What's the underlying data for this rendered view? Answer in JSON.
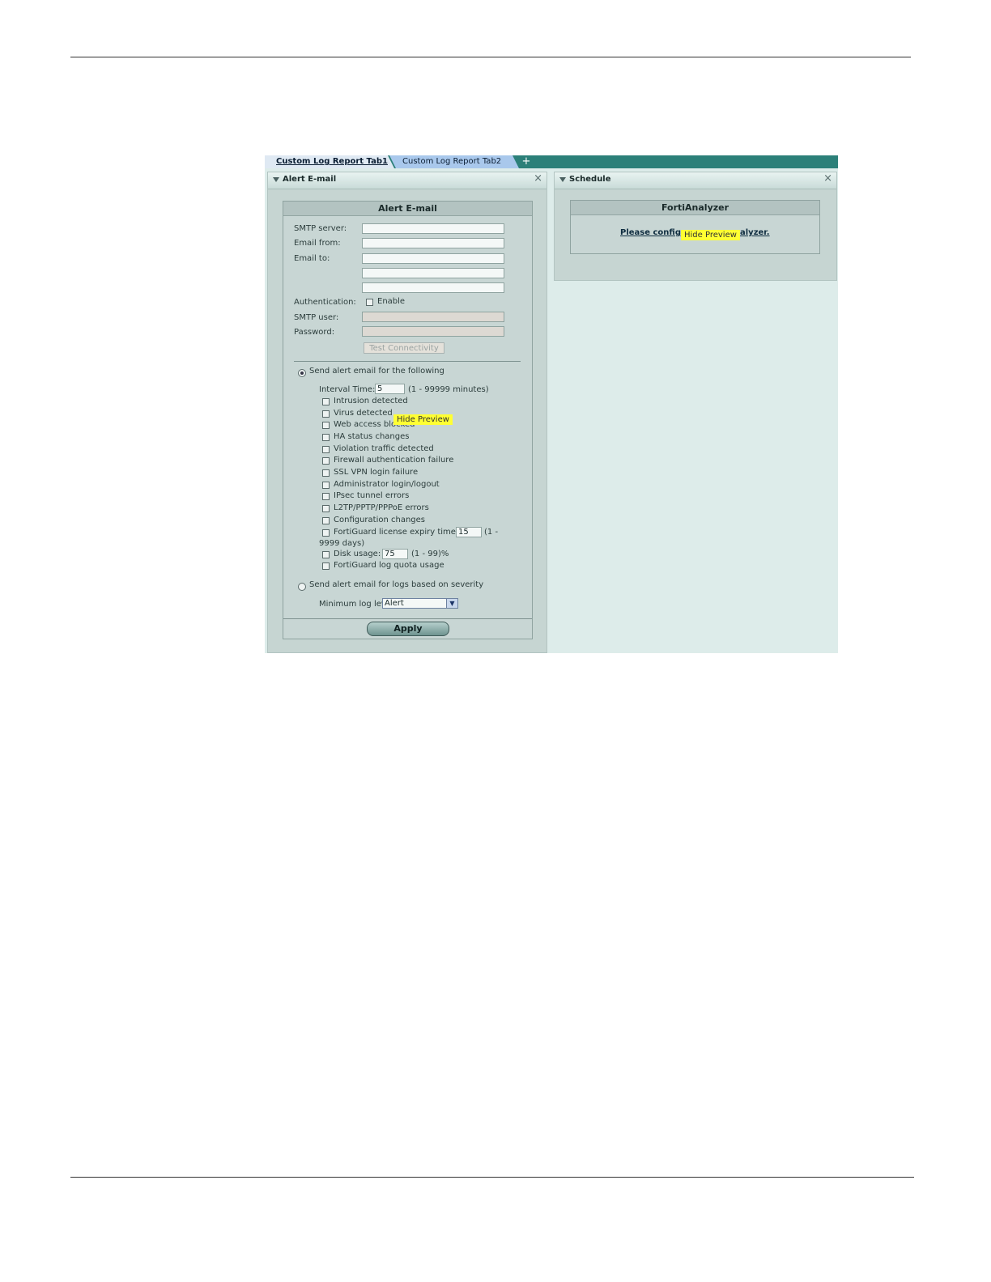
{
  "tabs": {
    "tab1": "Custom Log Report Tab1",
    "tab2": "Custom Log Report Tab2",
    "add": "+"
  },
  "alert_panel": {
    "title": "Alert E-mail",
    "close": "×",
    "section_title": "Alert E-mail",
    "smtp_server_label": "SMTP server:",
    "email_from_label": "Email from:",
    "email_to_label": "Email to:",
    "authentication_label": "Authentication:",
    "enable_label": "Enable",
    "smtp_user_label": "SMTP user:",
    "password_label": "Password:",
    "test_connectivity": "Test Connectivity",
    "send_following_label": "Send alert email for the following",
    "interval_label": "Interval Time:",
    "interval_value": "5",
    "interval_range": "(1 - 99999 minutes)",
    "events": [
      "Intrusion detected",
      "Virus detected",
      "Web access blocked",
      "HA status changes",
      "Violation traffic detected",
      "Firewall authentication failure",
      "SSL VPN login failure",
      "Administrator login/logout",
      "IPsec tunnel errors",
      "L2TP/PPTP/PPPoE errors",
      "Configuration changes"
    ],
    "fortiguard_label": "FortiGuard license expiry time:",
    "fortiguard_value": "15",
    "fortiguard_range_a": "(1 -",
    "fortiguard_range_b": "9999 days)",
    "disk_label": "Disk usage:",
    "disk_value": "75",
    "disk_range": "(1 - 99)%",
    "log_quota_label": "FortiGuard log quota usage",
    "send_severity_label": "Send alert email for logs based on severity",
    "min_log_label": "Minimum log level:",
    "min_log_value": "Alert",
    "apply": "Apply",
    "tooltip": "Hide Preview"
  },
  "schedule_panel": {
    "title": "Schedule",
    "close": "×",
    "section_title": "FortiAnalyzer",
    "link_left": "Please configu",
    "link_right": "alyzer.",
    "tooltip": "Hide Preview"
  }
}
